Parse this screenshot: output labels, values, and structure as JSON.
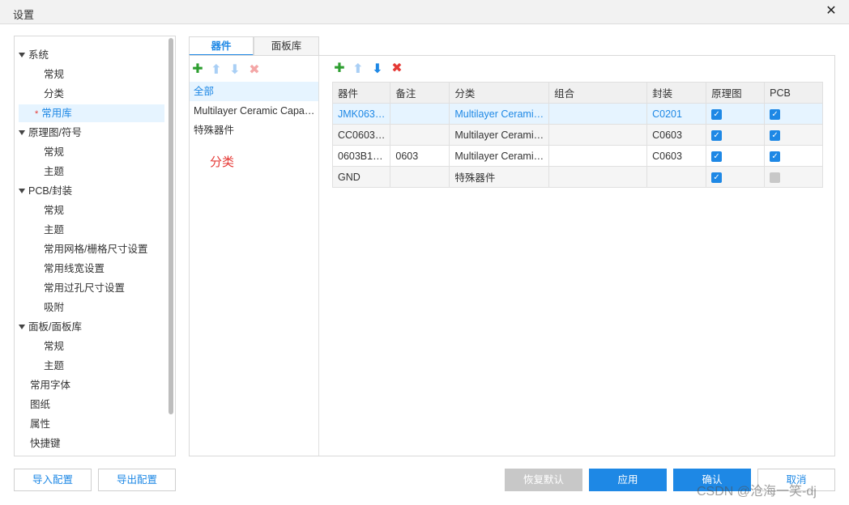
{
  "window": {
    "title": "设置",
    "close_glyph": "✕"
  },
  "tree": {
    "items": [
      {
        "label": "系统",
        "level": 0,
        "expanded": true
      },
      {
        "label": "常规",
        "level": 1
      },
      {
        "label": "分类",
        "level": 1
      },
      {
        "label": "常用库",
        "level": 1,
        "selected": true,
        "starred": true
      },
      {
        "label": "原理图/符号",
        "level": 0,
        "expanded": true
      },
      {
        "label": "常规",
        "level": 1
      },
      {
        "label": "主题",
        "level": 1
      },
      {
        "label": "PCB/封装",
        "level": 0,
        "expanded": true
      },
      {
        "label": "常规",
        "level": 1
      },
      {
        "label": "主题",
        "level": 1
      },
      {
        "label": "常用网格/栅格尺寸设置",
        "level": 1
      },
      {
        "label": "常用线宽设置",
        "level": 1
      },
      {
        "label": "常用过孔尺寸设置",
        "level": 1
      },
      {
        "label": "吸附",
        "level": 1
      },
      {
        "label": "面板/面板库",
        "level": 0,
        "expanded": true
      },
      {
        "label": "常规",
        "level": 1
      },
      {
        "label": "主题",
        "level": 1
      },
      {
        "label": "常用字体",
        "level": 0
      },
      {
        "label": "图纸",
        "level": 0
      },
      {
        "label": "属性",
        "level": 0
      },
      {
        "label": "快捷键",
        "level": 0
      }
    ]
  },
  "tabs": [
    {
      "label": "器件",
      "active": true
    },
    {
      "label": "面板库",
      "active": false
    }
  ],
  "categories": {
    "items": [
      {
        "label": "全部",
        "selected": true
      },
      {
        "label": "Multilayer Ceramic Capac…",
        "selected": false
      },
      {
        "label": "特殊器件",
        "selected": false
      }
    ],
    "annotation": "分类"
  },
  "toolbar_icons": {
    "add": "✚",
    "up": "⬆",
    "down": "⬇",
    "delete": "✖"
  },
  "table": {
    "headers": [
      "器件",
      "备注",
      "分类",
      "组合",
      "封装",
      "原理图",
      "PCB"
    ],
    "rows": [
      {
        "device": "JMK063…",
        "note": "",
        "category": "Multilayer Cerami…",
        "combo": "",
        "footprint": "C0201",
        "schematic": true,
        "pcb": true,
        "style": "selected"
      },
      {
        "device": "CC0603…",
        "note": "",
        "category": "Multilayer Cerami…",
        "combo": "",
        "footprint": "C0603",
        "schematic": true,
        "pcb": true,
        "style": "alt"
      },
      {
        "device": "0603B1…",
        "note": "0603",
        "category": "Multilayer Cerami…",
        "combo": "",
        "footprint": "C0603",
        "schematic": true,
        "pcb": true,
        "style": "normal"
      },
      {
        "device": "GND",
        "note": "",
        "category": "特殊器件",
        "combo": "",
        "footprint": "",
        "schematic": true,
        "pcb": false,
        "style": "alt"
      }
    ]
  },
  "buttons": {
    "import": "导入配置",
    "export": "导出配置",
    "restore": "恢复默认",
    "apply": "应用",
    "ok": "确认",
    "cancel": "取消"
  },
  "watermark": "CSDN @沧海一笑-dj",
  "colors": {
    "accent": "#1e88e5",
    "add_green": "#2e9e30",
    "delete_red": "#e53935"
  }
}
